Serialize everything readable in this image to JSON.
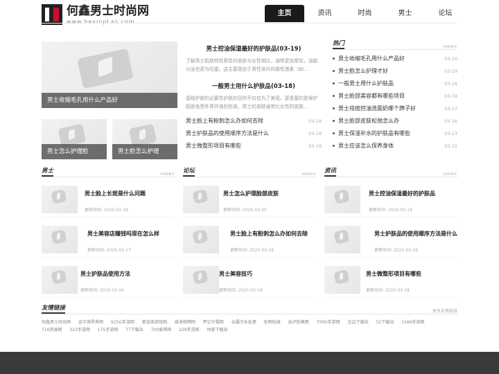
{
  "site": {
    "title": "何鑫男士时尚网",
    "subtitle": "www.hexinpLas.com"
  },
  "nav": [
    "主页",
    "资讯",
    "时尚",
    "男士",
    "论坛"
  ],
  "feature": {
    "big_caption": "男士收缩毛孔用什么产品好",
    "small": [
      "男士怎么护理脸",
      "男士脸怎么护理"
    ]
  },
  "headline": [
    {
      "title": "男士控油保湿最好的护肤品(03-19)",
      "desc": "了解男士肌肤特性男性的皮肤与女性相比，通常更加厚实，油脂分泌也更为旺盛。这主要是由于男性体内的雄性激素（如..."
    },
    {
      "title": "一般男士用什么护肤品(03-18)",
      "desc": "基础护肤的必要性护肤的目的不仅仅为了美观，更重要的是保护肌肤免受外界环境的伤害。男士的皮肤通常比女性的皮肤..."
    }
  ],
  "center_list": [
    {
      "title": "男士脸上有粉刺怎么办如何去除",
      "date": "03-18"
    },
    {
      "title": "男士护肤品的使用顺序方法是什么",
      "date": "03-18"
    },
    {
      "title": "男士微整形项目有哪些",
      "date": "03-18"
    }
  ],
  "sidebar": {
    "title": "热门",
    "more": "more+",
    "items": [
      {
        "title": "男士收缩毛孔用什么产品好",
        "date": "03-20"
      },
      {
        "title": "男士脸怎么护理才好",
        "date": "03-19"
      },
      {
        "title": "一般男士用什么护肤品",
        "date": "03-18"
      },
      {
        "title": "男士脸部美容都有哪些项目",
        "date": "03-18"
      },
      {
        "title": "男士祛痘控油洗面奶哪个牌子好",
        "date": "03-17"
      },
      {
        "title": "男士脸部皮肤松弛怎么办",
        "date": "03-16"
      },
      {
        "title": "男士保湿补水的护肤品有哪些",
        "date": "03-13"
      },
      {
        "title": "男士应该怎么保养身体",
        "date": "03-11"
      }
    ]
  },
  "sections": [
    {
      "title": "男士",
      "more": "more+",
      "items": [
        {
          "title": "男士脸上长斑是什么问题",
          "meta": "更新时间:   2025-03-18"
        },
        {
          "title": "男士美容店赚钱吗现在怎么样",
          "meta": "更新时间:   2025-03-17"
        },
        {
          "title": "男士护肤品使用方法",
          "meta": "更新时间:   2025-03-16"
        }
      ]
    },
    {
      "title": "论坛",
      "more": "more+",
      "items": [
        {
          "title": "男士怎么护理脸部皮肤",
          "meta": "更新时间:   2025-03-20"
        },
        {
          "title": "男士脸上有粉刺怎么办如何去除",
          "meta": "更新时间:   2025-03-18"
        },
        {
          "title": "男士美容技巧",
          "meta": "更新时间:   2025-03-18"
        }
      ]
    },
    {
      "title": "资讯",
      "more": "more+",
      "items": [
        {
          "title": "男士控油保湿最好的护肤品",
          "meta": "更新时间:   2025-03-19"
        },
        {
          "title": "男士护肤品的使用顺序方法是什么",
          "meta": "更新时间:   2025-03-18"
        },
        {
          "title": "男士微整形项目有哪些",
          "meta": "更新时间:   2025-03-18"
        }
      ]
    }
  ],
  "links": {
    "title": "友情链接",
    "more": "更多友情链接",
    "items": [
      "何鑫男士时尚网",
      "金字律界秀网",
      "925G手游网",
      "紫金阁游戏网",
      "威海棋牌网",
      "梦幻冷帽网",
      "云霸污水处理",
      "佐明机械",
      "亲泸航模网",
      "700G手游网",
      "左边下载站",
      "52下载站",
      "1166手游网",
      "716资源网",
      "323手游网",
      "175手游网",
      "77下载站",
      "700爱棋网",
      "229手游网",
      "恒爱下载站"
    ]
  }
}
